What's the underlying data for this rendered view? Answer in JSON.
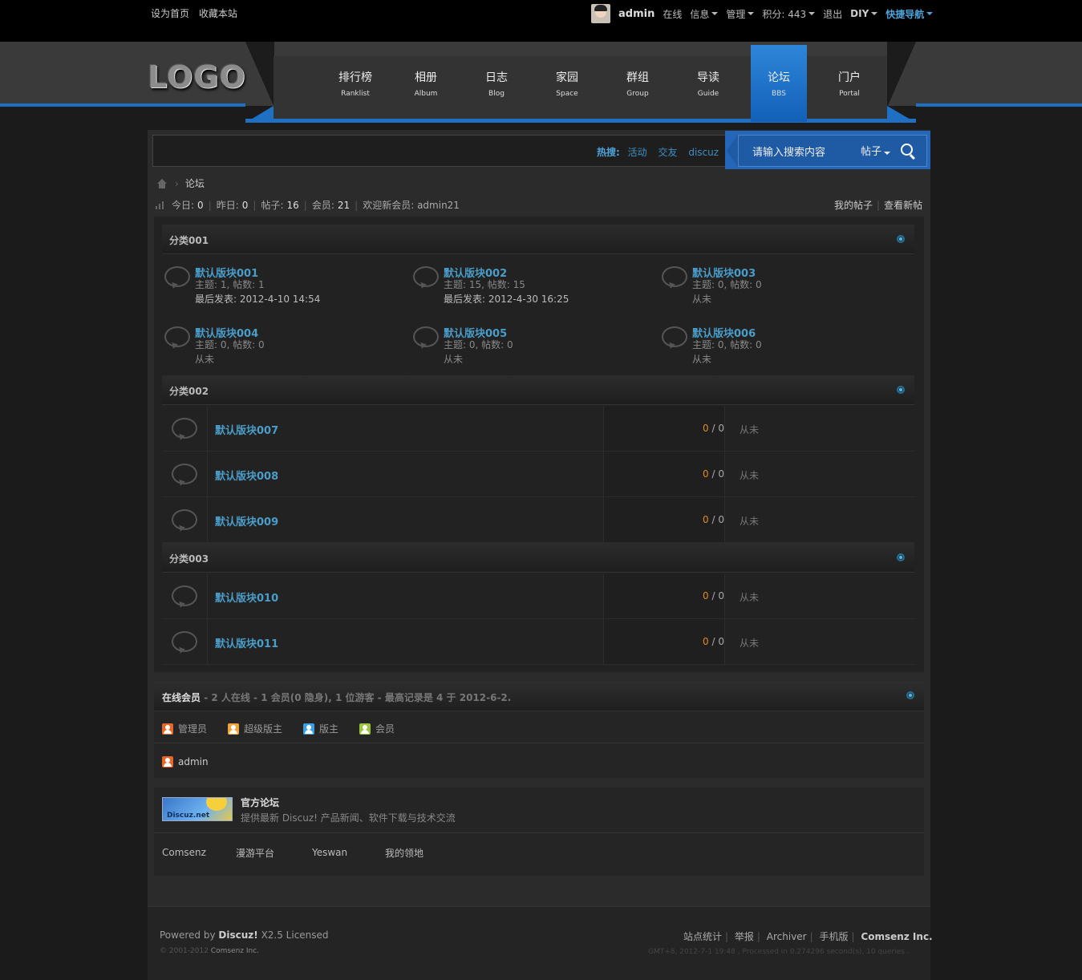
{
  "topbar": {
    "set_home": "设为首页",
    "bookmark": "收藏本站",
    "username": "admin",
    "online": "在线",
    "messages": "信息",
    "manage": "管理",
    "points": "积分: 443",
    "logout": "退出",
    "diy": "DIY",
    "quick_nav": "快捷导航"
  },
  "logo": "LOGO",
  "nav": [
    {
      "cn": "排行榜",
      "en": "Ranklist"
    },
    {
      "cn": "相册",
      "en": "Album"
    },
    {
      "cn": "日志",
      "en": "Blog"
    },
    {
      "cn": "家园",
      "en": "Space"
    },
    {
      "cn": "群组",
      "en": "Group"
    },
    {
      "cn": "导读",
      "en": "Guide"
    },
    {
      "cn": "论坛",
      "en": "BBS"
    },
    {
      "cn": "门户",
      "en": "Portal"
    }
  ],
  "search": {
    "hot_label": "热搜:",
    "hot": [
      "活动",
      "交友",
      "discuz"
    ],
    "placeholder": "请输入搜索内容",
    "type": "帖子"
  },
  "breadcrumb": "论坛",
  "stats": {
    "today_label": "今日:",
    "today": "0",
    "yesterday_label": "昨日:",
    "yesterday": "0",
    "posts_label": "帖子:",
    "posts": "16",
    "members_label": "会员:",
    "members": "21",
    "welcome": "欢迎新会员: admin21",
    "my_posts": "我的帖子",
    "new_posts": "查看新帖"
  },
  "categories": [
    {
      "title": "分类001",
      "forums": [
        {
          "name": "默认版块001",
          "stats": "主题: 1, 帖数: 1",
          "last": "最后发表: 2012-4-10 14:54"
        },
        {
          "name": "默认版块002",
          "stats": "主题: 15, 帖数: 15",
          "last": "最后发表: 2012-4-30 16:25"
        },
        {
          "name": "默认版块003",
          "stats": "主题: 0, 帖数: 0",
          "last": "从未"
        },
        {
          "name": "默认版块004",
          "stats": "主题: 0, 帖数: 0",
          "last": "从未"
        },
        {
          "name": "默认版块005",
          "stats": "主题: 0, 帖数: 0",
          "last": "从未"
        },
        {
          "name": "默认版块006",
          "stats": "主题: 0, 帖数: 0",
          "last": "从未"
        }
      ]
    },
    {
      "title": "分类002",
      "forums": [
        {
          "name": "默认版块007",
          "threads": "0",
          "posts": "0",
          "last": "从未"
        },
        {
          "name": "默认版块008",
          "threads": "0",
          "posts": "0",
          "last": "从未"
        },
        {
          "name": "默认版块009",
          "threads": "0",
          "posts": "0",
          "last": "从未"
        }
      ]
    },
    {
      "title": "分类003",
      "forums": [
        {
          "name": "默认版块010",
          "threads": "0",
          "posts": "0",
          "last": "从未"
        },
        {
          "name": "默认版块011",
          "threads": "0",
          "posts": "0",
          "last": "从未"
        }
      ]
    }
  ],
  "online": {
    "title": "在线会员",
    "summary": " - 2 人在线 - 1 会员(0 隐身), 1 位游客 - 最高记录是 4 于 2012-6-2.",
    "legend": [
      {
        "label": "管理员",
        "color": "#e8662a"
      },
      {
        "label": "超级版主",
        "color": "#f0a33a"
      },
      {
        "label": "版主",
        "color": "#3aa0e0"
      },
      {
        "label": "会员",
        "color": "#9bc53d"
      }
    ],
    "user": "admin",
    "user_color": "#e8662a"
  },
  "links": {
    "logo_text": "Discuz.net",
    "title": "官方论坛",
    "desc": "提供最新 Discuz! 产品新闻、软件下载与技术交流",
    "items": [
      "Comsenz",
      "漫游平台",
      "Yeswan",
      "我的领地"
    ]
  },
  "footer": {
    "powered_prefix": "Powered by",
    "powered_brand": "Discuz!",
    "powered_suffix": "X2.5 Licensed",
    "copyright_prefix": "© 2001-2012",
    "copyright_company": "Comsenz Inc.",
    "links": [
      "站点统计",
      "举报",
      "Archiver",
      "手机版"
    ],
    "company": "Comsenz Inc.",
    "gmt": "GMT+8, 2012-7-1 19:48 , Processed in 0.274296 second(s), 10 queries ."
  },
  "colors": {
    "accent": "#1f6fc2",
    "link": "#4a9dc9",
    "count_highlight": "#e08a1e"
  }
}
